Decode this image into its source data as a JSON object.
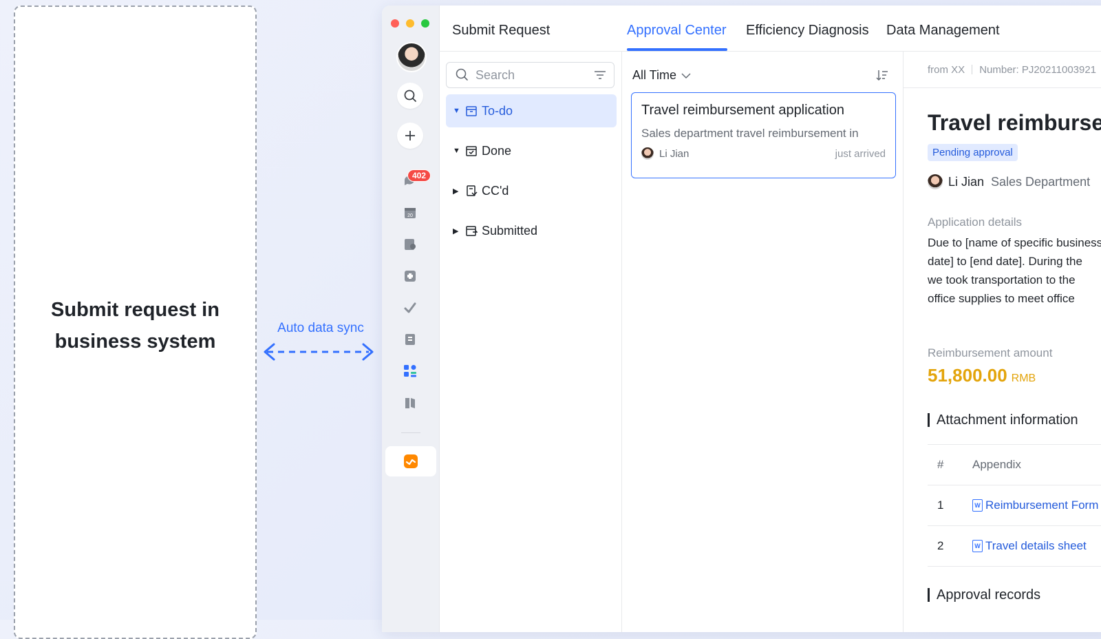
{
  "left_panel": {
    "text": "Submit request in business system"
  },
  "sync": {
    "label": "Auto data sync"
  },
  "colors": {
    "accent": "#3370ff",
    "amount": "#e3a40b",
    "badge": "#f54a45",
    "red": "#ff5f57",
    "yellow": "#febc2e",
    "green": "#28c840"
  },
  "rail": {
    "badge_count": "402",
    "icons": [
      "search-icon",
      "plus-icon",
      "messages-icon",
      "calendar-icon",
      "docs-icon",
      "workplace-icon",
      "tasks-icon",
      "wiki-icon",
      "apps-icon",
      "books-icon",
      "approval-app-icon"
    ],
    "calendar_day": "20"
  },
  "tabs": [
    "Submit Request",
    "Approval Center",
    "Efficiency Diagnosis",
    "Data Management"
  ],
  "sidebar": {
    "search_placeholder": "Search",
    "items": [
      {
        "label": "To-do",
        "expanded": true
      },
      {
        "label": "Done",
        "expanded": true
      },
      {
        "label": "CC'd",
        "expanded": false
      },
      {
        "label": "Submitted",
        "expanded": false
      }
    ]
  },
  "list": {
    "filter": "All Time",
    "card": {
      "title": "Travel reimbursement application",
      "desc": "Sales department travel reimbursement in",
      "user": "Li Jian",
      "time": "just arrived"
    }
  },
  "detail": {
    "from": "from XX",
    "number": "Number: PJ20211003921",
    "title": "Travel reimbursement application",
    "status": "Pending approval",
    "user": "Li Jian",
    "dept": "Sales Department",
    "app_details_label": "Application details",
    "body_lines": [
      "Due to [name of specific business",
      "date] to [end date]. During the",
      "we took transportation to the",
      "office supplies to meet office"
    ],
    "amount_label": "Reimbursement amount",
    "amount": "51,800.00",
    "currency": "RMB",
    "attachment_title": "Attachment information",
    "table_headers": [
      "#",
      "Appendix"
    ],
    "attachments": [
      {
        "no": "1",
        "name": "Reimbursement Form"
      },
      {
        "no": "2",
        "name": "Travel details sheet"
      }
    ],
    "approval_title": "Approval records"
  }
}
